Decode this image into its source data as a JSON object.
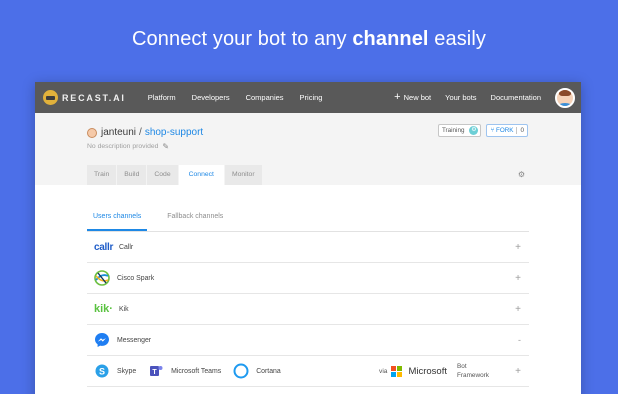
{
  "headline": {
    "prefix": "Connect your bot to any ",
    "bold": "channel",
    "suffix": " easily"
  },
  "colors": {
    "background": "#4c6fe8",
    "accent": "#1e88e5",
    "nav": "#595959"
  },
  "nav": {
    "logo_text": "RECAST.AI",
    "links": [
      "Platform",
      "Developers",
      "Companies",
      "Pricing"
    ],
    "new_bot": "New bot",
    "your_bots": "Your bots",
    "documentation": "Documentation"
  },
  "repo": {
    "owner": "janteuni",
    "separator": "/",
    "name": "shop-support",
    "description": "No description provided",
    "training_label": "Training",
    "fork_label": "FORK",
    "fork_count": "0"
  },
  "tabs": [
    "Train",
    "Build",
    "Code",
    "Connect",
    "Monitor"
  ],
  "active_tab": "Connect",
  "subtabs": [
    "Users channels",
    "Fallback channels"
  ],
  "channels": [
    {
      "logo": "callr",
      "name": "Callr",
      "state": "+"
    },
    {
      "logo": "cisco-spark-icon",
      "name": "Cisco Spark",
      "state": "+"
    },
    {
      "logo": "kik",
      "name": "Kik",
      "state": "+"
    },
    {
      "logo": "messenger-icon",
      "name": "Messenger",
      "state": "-"
    }
  ],
  "multi_channel": {
    "items": [
      "Skype",
      "Microsoft Teams",
      "Cortana"
    ],
    "via": "via",
    "provider": "Microsoft",
    "framework": "Bot Framework",
    "state": "+"
  }
}
